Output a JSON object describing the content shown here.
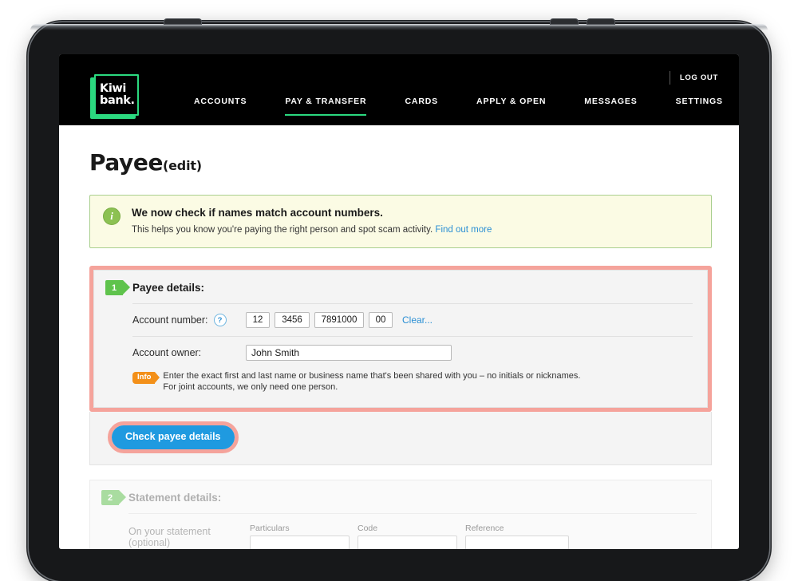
{
  "device": {
    "type": "tablet"
  },
  "header": {
    "logo": {
      "line1": "Kiwi",
      "line2": "bank."
    },
    "logout_label": "LOG OUT",
    "nav": [
      {
        "label": "ACCOUNTS",
        "active": false
      },
      {
        "label": "PAY & TRANSFER",
        "active": true
      },
      {
        "label": "CARDS",
        "active": false
      },
      {
        "label": "APPLY & OPEN",
        "active": false
      },
      {
        "label": "MESSAGES",
        "active": false
      },
      {
        "label": "SETTINGS",
        "active": false
      }
    ]
  },
  "page": {
    "title": "Payee",
    "subtitle": "(edit)"
  },
  "notice": {
    "icon": "info-circle-icon",
    "title": "We now check if names match account numbers.",
    "body": "This helps you know you're paying the right person and spot scam activity.",
    "link_label": "Find out more"
  },
  "section_payee": {
    "step_number": "1",
    "title": "Payee details:",
    "account_number": {
      "label": "Account number:",
      "help_icon": "question-mark-icon",
      "segments": [
        {
          "name": "bank",
          "value": "12"
        },
        {
          "name": "branch",
          "value": "3456"
        },
        {
          "name": "account",
          "value": "7891000"
        },
        {
          "name": "suffix",
          "value": "00"
        }
      ],
      "clear_label": "Clear..."
    },
    "account_owner": {
      "label": "Account owner:",
      "value": "John Smith",
      "placeholder": ""
    },
    "hint": {
      "badge": "Info",
      "line1": "Enter the exact first and last name or business name that's been shared with you – no initials or nicknames.",
      "line2": "For joint accounts, we only need one person."
    }
  },
  "check_panel": {
    "button_label": "Check payee details"
  },
  "section_statement": {
    "step_number": "2",
    "title": "Statement details:",
    "row_label": "On your statement",
    "row_label_optional": "(optional)",
    "fields": [
      {
        "label": "Particulars",
        "value": ""
      },
      {
        "label": "Code",
        "value": ""
      },
      {
        "label": "Reference",
        "value": ""
      }
    ],
    "fields_row2": [
      {
        "label": "",
        "value": ""
      },
      {
        "label": "",
        "value": ""
      },
      {
        "label": "",
        "value": ""
      }
    ]
  },
  "colors": {
    "brand_green": "#2bd97f",
    "step_green": "#5fc34c",
    "link_blue": "#2a8fd4",
    "button_blue": "#1f9ae0",
    "highlight_pink": "#f5a39b",
    "info_orange": "#f39019",
    "notice_bg": "#fbfbe4",
    "notice_border": "#a9cf8e"
  }
}
